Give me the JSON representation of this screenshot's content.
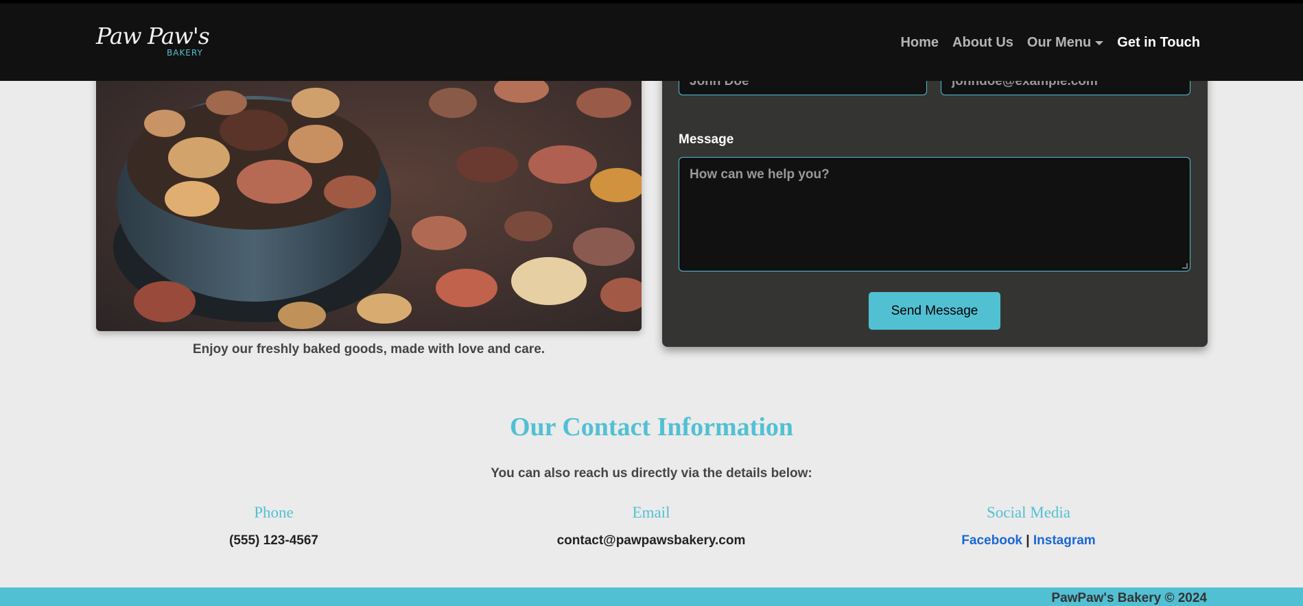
{
  "nav": {
    "logo_script": "Paw Paw's",
    "logo_sub": "BAKERY",
    "links": [
      {
        "label": "Home"
      },
      {
        "label": "About Us"
      },
      {
        "label": "Our Menu"
      },
      {
        "label": "Get in Touch"
      }
    ]
  },
  "hero": {
    "caption": "Enjoy our freshly baked goods, made with love and care."
  },
  "form": {
    "name_placeholder": "John Doe",
    "email_placeholder": "johndoe@example.com",
    "message_label": "Message",
    "message_placeholder": "How can we help you?",
    "send_label": "Send Message"
  },
  "contact": {
    "title": "Our Contact Information",
    "subtitle": "You can also reach us directly via the details below:",
    "phone_heading": "Phone",
    "phone_value": "(555) 123-4567",
    "email_heading": "Email",
    "email_value": "contact@pawpawsbakery.com",
    "social_heading": "Social Media",
    "facebook": "Facebook",
    "separator": "|",
    "instagram": "Instagram"
  },
  "footer": {
    "text": "PawPaw's Bakery © 2024"
  },
  "colors": {
    "accent": "#52c0d3",
    "nav_bg": "#111111",
    "card_bg": "#343532",
    "link": "#1a66d8"
  }
}
